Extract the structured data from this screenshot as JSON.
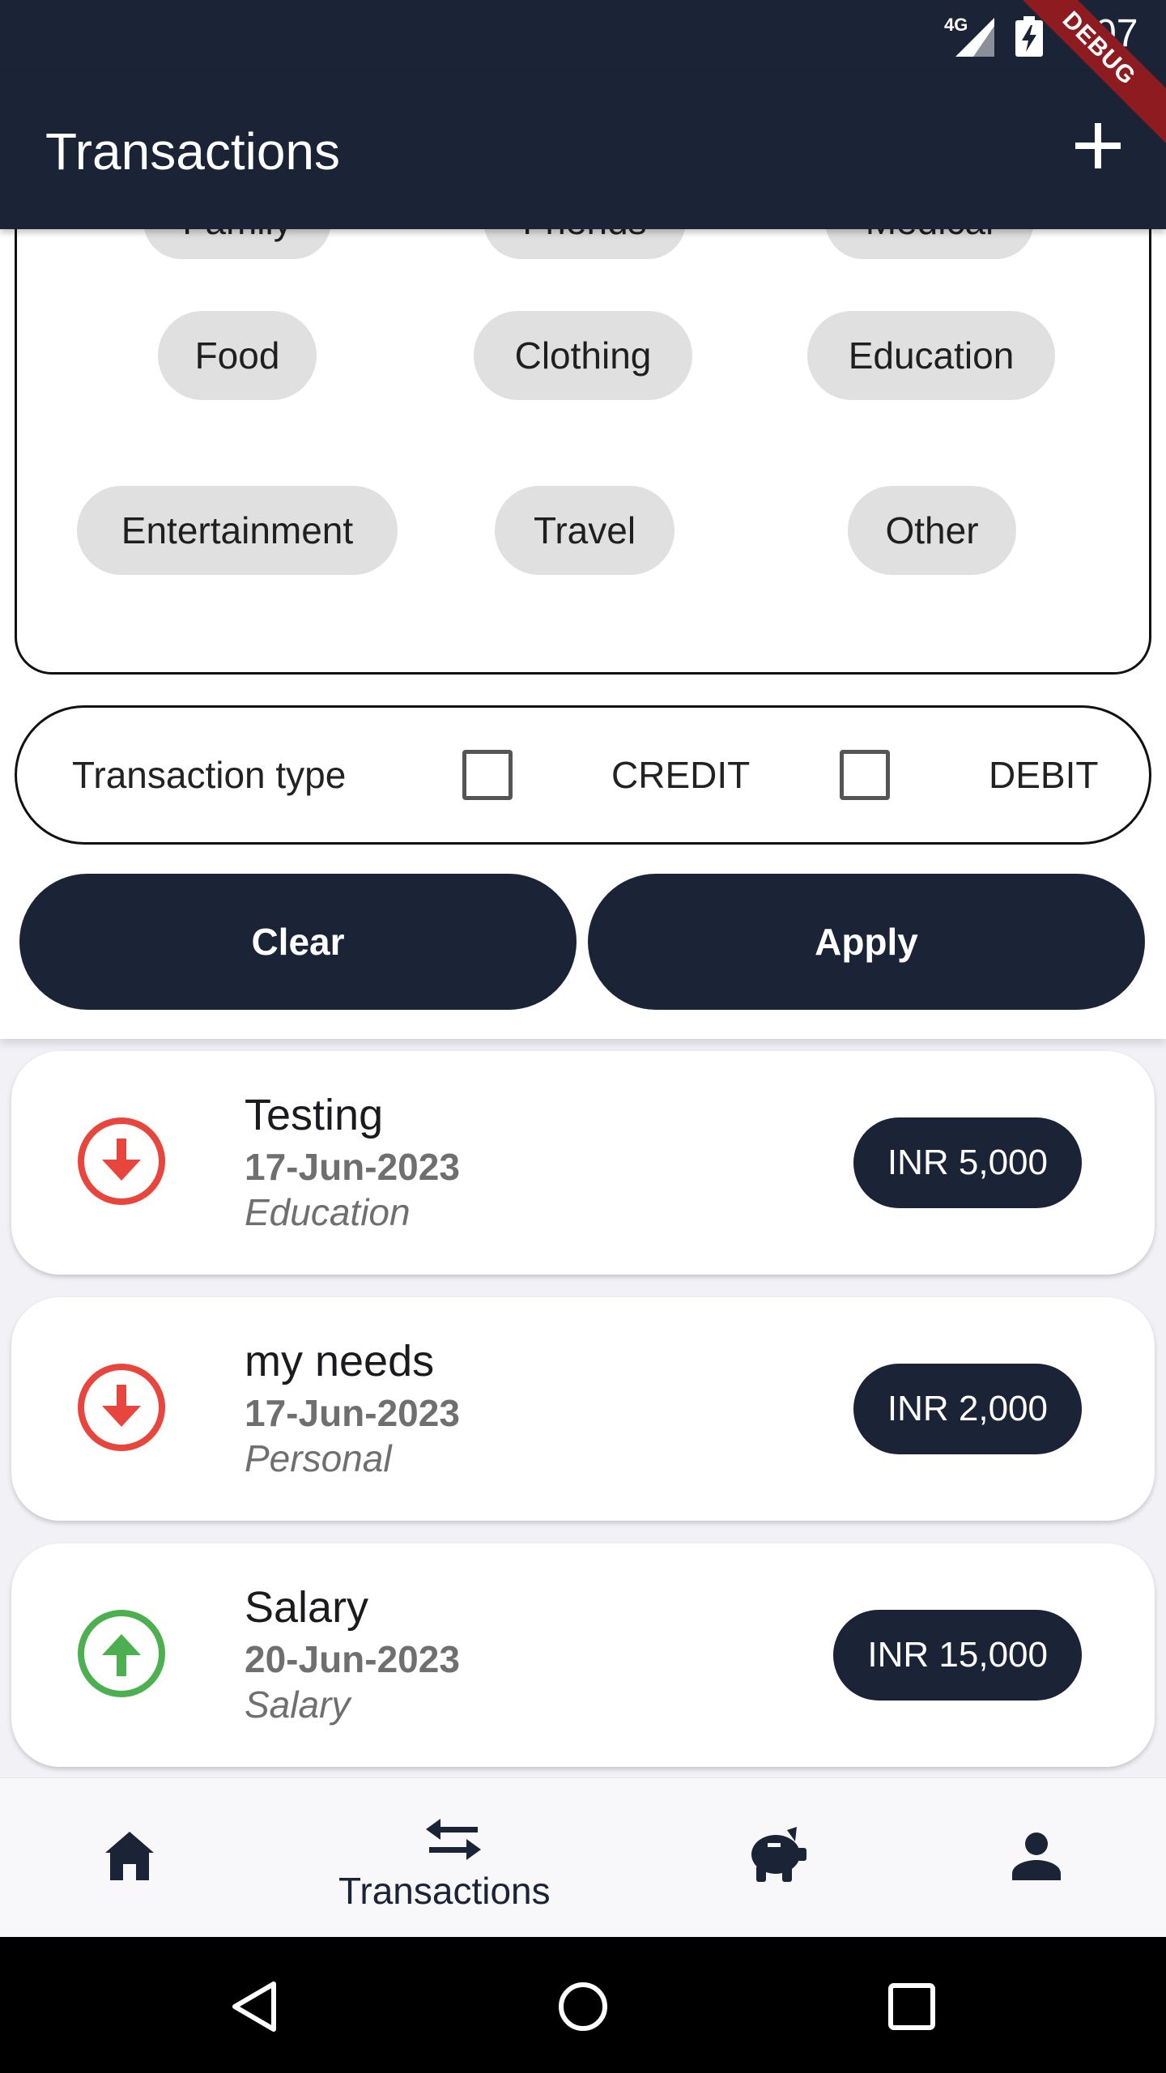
{
  "status_bar": {
    "network": "4G",
    "time": "7:07",
    "debug_label": "DEBUG"
  },
  "app_bar": {
    "title": "Transactions"
  },
  "categories": {
    "row_partial": [
      "Family",
      "Friends",
      "Medical"
    ],
    "row1": [
      "Food",
      "Clothing",
      "Education"
    ],
    "row2": [
      "Entertainment",
      "Travel",
      "Other"
    ]
  },
  "transaction_type": {
    "label": "Transaction type",
    "credit": "CREDIT",
    "debit": "DEBIT",
    "credit_checked": false,
    "debit_checked": false
  },
  "actions": {
    "clear": "Clear",
    "apply": "Apply"
  },
  "transactions": [
    {
      "title": "Testing",
      "date": "17-Jun-2023",
      "category": "Education",
      "amount": "INR 5,000",
      "direction": "debit",
      "icon": "arrow-down-circle-icon"
    },
    {
      "title": "my needs",
      "date": "17-Jun-2023",
      "category": "Personal",
      "amount": "INR 2,000",
      "direction": "debit",
      "icon": "arrow-down-circle-icon"
    },
    {
      "title": "Salary",
      "date": "20-Jun-2023",
      "category": "Salary",
      "amount": "INR 15,000",
      "direction": "credit",
      "icon": "arrow-up-circle-icon"
    }
  ],
  "bottom_nav": {
    "active_label": "Transactions",
    "items": [
      "home-icon",
      "transfer-icon",
      "piggy-bank-icon",
      "person-icon"
    ]
  },
  "colors": {
    "primary": "#1b2336",
    "debit": "#e8453c",
    "credit": "#4caf50",
    "chip": "#e0e0e0",
    "debug": "#8e1b1f"
  }
}
